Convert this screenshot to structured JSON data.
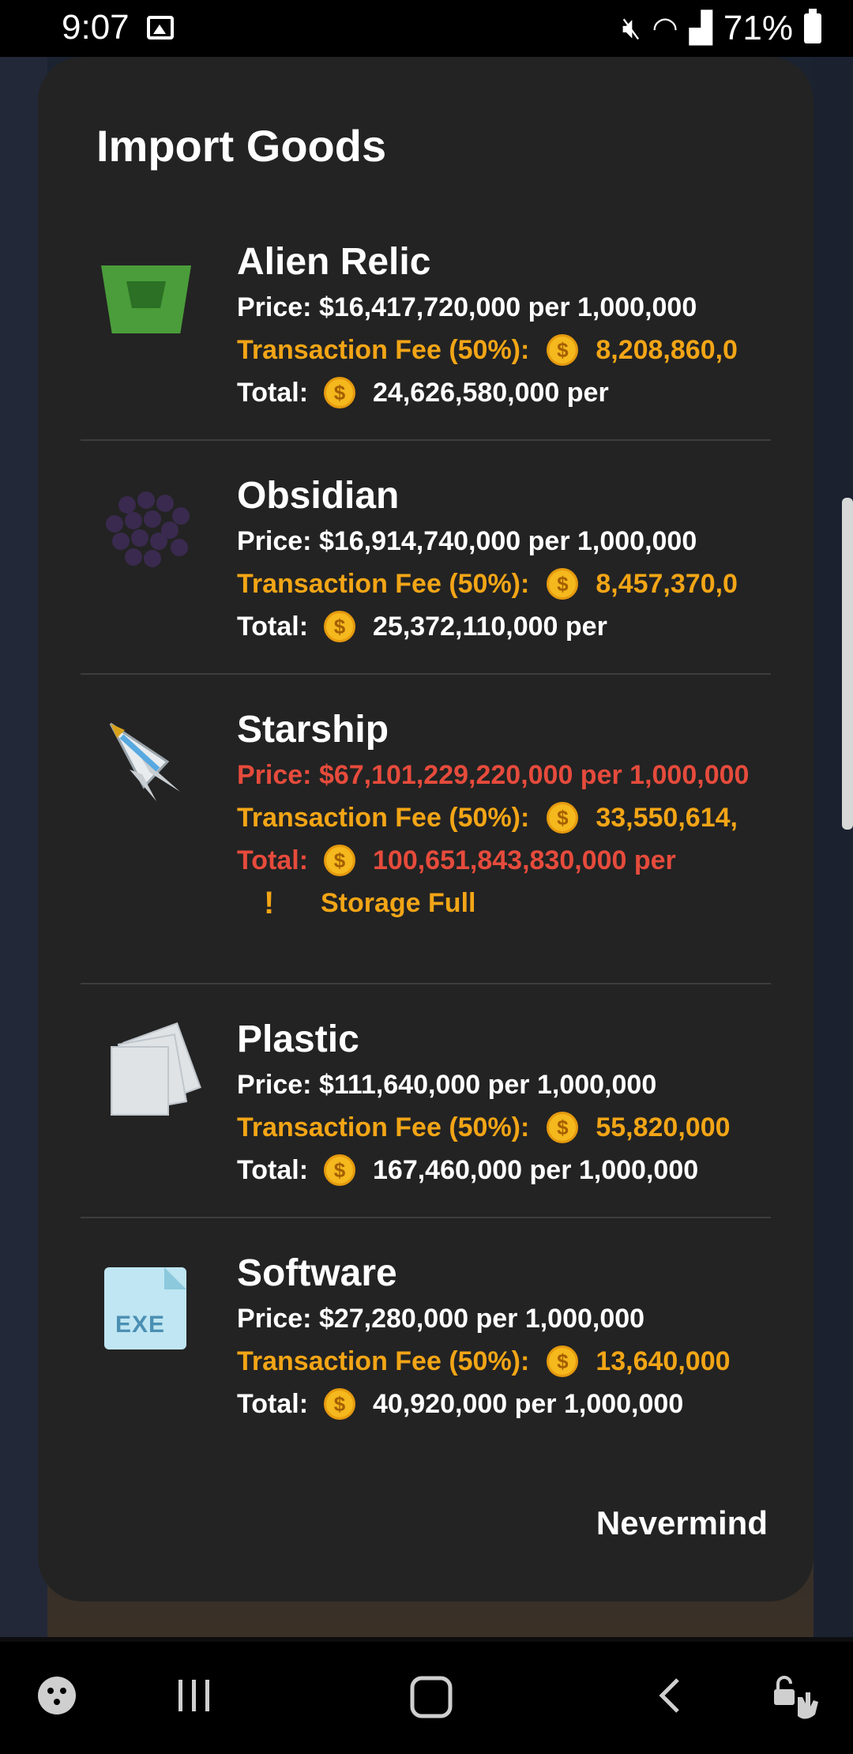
{
  "status_bar": {
    "time": "9:07",
    "battery": "71%",
    "icons": [
      "gallery-icon",
      "mute-icon",
      "wifi-icon",
      "signal-icon",
      "battery-icon"
    ]
  },
  "dialog": {
    "title": "Import Goods",
    "dismiss_label": "Nevermind",
    "items": [
      {
        "name": "Alien Relic",
        "icon": "alien-relic-icon",
        "price": "Price: $16,417,720,000 per 1,000,000",
        "fee_label": "Transaction Fee (50%):",
        "fee_value": "8,208,860,0",
        "total_label": "Total:",
        "total_value": "24,626,580,000 per"
      },
      {
        "name": "Obsidian",
        "icon": "obsidian-icon",
        "price": "Price: $16,914,740,000 per 1,000,000",
        "fee_label": "Transaction Fee (50%):",
        "fee_value": "8,457,370,0",
        "total_label": "Total:",
        "total_value": "25,372,110,000 per"
      },
      {
        "name": "Starship",
        "icon": "starship-icon",
        "price": "Price: $67,101,229,220,000 per 1,000,000",
        "fee_label": "Transaction Fee (50%):",
        "fee_value": "33,550,614,",
        "total_label": "Total:",
        "total_value": "100,651,843,830,000 per",
        "warning": "Storage Full"
      },
      {
        "name": "Plastic",
        "icon": "plastic-icon",
        "price": "Price: $111,640,000 per 1,000,000",
        "fee_label": "Transaction Fee (50%):",
        "fee_value": "55,820,000",
        "total_label": "Total:",
        "total_value": "167,460,000 per 1,000,000"
      },
      {
        "name": "Software",
        "icon": "software-icon",
        "icon_text": "EXE",
        "price": "Price: $27,280,000 per 1,000,000",
        "fee_label": "Transaction Fee (50%):",
        "fee_value": "13,640,000",
        "total_label": "Total:",
        "total_value": "40,920,000 per 1,000,000"
      }
    ]
  },
  "coin_symbol": "$",
  "warning_symbol": "!",
  "colors": {
    "dialog_bg": "#232323",
    "fee_orange": "#f2a516",
    "error_red": "#e64b3c",
    "coin_gold": "#f5b81d"
  },
  "nav_bar": {
    "icons": [
      "game-tools-icon",
      "recent-apps-icon",
      "home-icon",
      "back-icon",
      "touch-lock-icon"
    ]
  }
}
